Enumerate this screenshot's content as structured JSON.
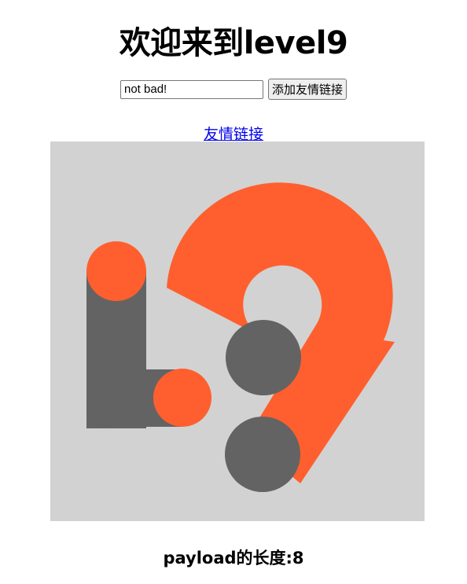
{
  "page": {
    "title": "欢迎来到level9"
  },
  "form": {
    "keyword_value": "not bad!",
    "submit_label": "添加友情链接"
  },
  "link": {
    "label": "友情链接"
  },
  "logo": {
    "description_icon": "level9-logo-image",
    "colors": {
      "background": "#d2d2d2",
      "orange": "#ff5f2e",
      "gray": "#636363"
    }
  },
  "footer": {
    "payload_length_text": "payload的长度:8"
  }
}
